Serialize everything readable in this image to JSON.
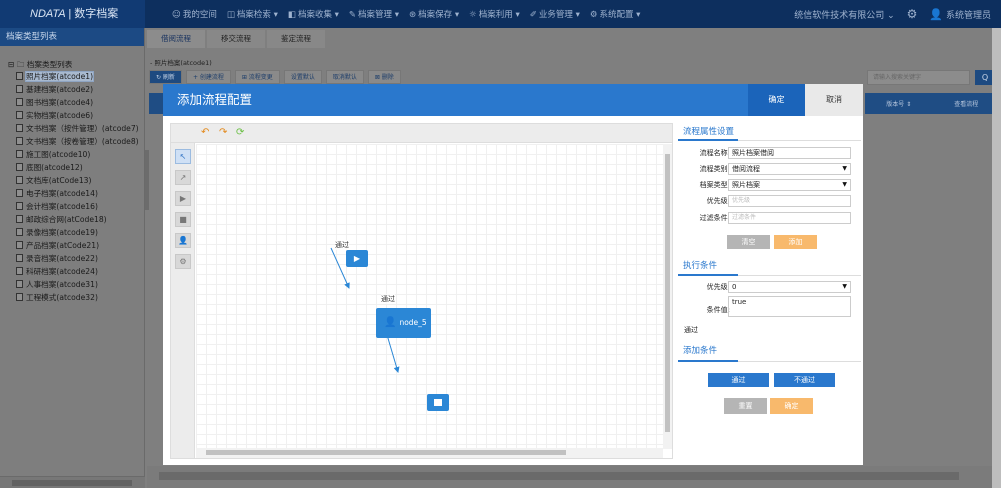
{
  "app": {
    "title_italic": "NDATA",
    "title_cn": "数字档案",
    "company": "统信软件技术有限公司",
    "user": "系统管理员"
  },
  "nav": [
    {
      "icon": "space-icon",
      "glyph": "☺",
      "label": "我的空间"
    },
    {
      "icon": "search-icon",
      "glyph": "◫",
      "label": "档案检索 ▾"
    },
    {
      "icon": "collect-icon",
      "glyph": "◧",
      "label": "档案收集 ▾"
    },
    {
      "icon": "manage-icon",
      "glyph": "✎",
      "label": "档案管理 ▾"
    },
    {
      "icon": "preserve-icon",
      "glyph": "⊛",
      "label": "档案保存 ▾"
    },
    {
      "icon": "use-icon",
      "glyph": "☼",
      "label": "档案利用 ▾"
    },
    {
      "icon": "business-icon",
      "glyph": "✐",
      "label": "业务管理 ▾"
    },
    {
      "icon": "config-icon",
      "glyph": "⚙",
      "label": "系统配置 ▾"
    }
  ],
  "sidebar": {
    "header": "档案类型列表",
    "root": "档案类型列表",
    "items": [
      "照片档案(atcode1)",
      "基建档案(atcode2)",
      "图书档案(atcode4)",
      "实物档案(atcode6)",
      "文书档案（按件管理）(atcode7)",
      "文书档案（按卷管理）(atcode8)",
      "施工图(atcode10)",
      "底图(atcode12)",
      "文档库(atCode13)",
      "电子档案(atcode14)",
      "会计档案(atcode16)",
      "邮政综合网(atCode18)",
      "录像档案(atcode19)",
      "产品档案(atCode21)",
      "录音档案(atcode22)",
      "科研档案(atcode24)",
      "人事档案(atcode31)",
      "工程模式(atcode32)"
    ]
  },
  "tabs": [
    "借阅流程",
    "移交流程",
    "鉴定流程"
  ],
  "breadcrumb": "- 照片档案(atcode1)",
  "toolbar": [
    "↻ 刷新",
    "+ 创建流程",
    "⊞ 流程变更",
    "设置默认",
    "取消默认",
    "⊠ 删除"
  ],
  "bg": {
    "search_placeholder": "请输入搜索关键字",
    "search_btn": "Q",
    "cols": [
      "版本号 ⇕",
      "查看流程"
    ]
  },
  "modal": {
    "title": "添加流程配置",
    "ok": "确定",
    "cancel": "取消",
    "designer": {
      "start_glyph": "▶",
      "task_label": "node_5",
      "edge_label_1": "通过",
      "edge_label_2": "通过",
      "palette": [
        "↖",
        "↗",
        "▶",
        "■",
        "👤",
        "⚙"
      ]
    },
    "props": {
      "section": "流程属性设置",
      "name_label": "流程名称:",
      "name_value": "照片档案借阅",
      "type_label": "流程类别:",
      "type_value": "借阅流程",
      "archive_label": "档案类型:",
      "archive_value": "照片档案",
      "priority_label": "优先级:",
      "priority_placeholder": "优先级",
      "filter_label": "过滤条件:",
      "filter_placeholder": "过滤条件",
      "clear": "清空",
      "add": "添加"
    },
    "exec": {
      "section": "执行条件",
      "priority_label": "优先级:",
      "priority_value": "0",
      "cond_label": "条件值:",
      "cond_value": "true",
      "result": "通过"
    },
    "addcond": {
      "section": "添加条件",
      "pass": "通过",
      "fail": "不通过",
      "reset": "重置",
      "confirm": "确定"
    }
  }
}
